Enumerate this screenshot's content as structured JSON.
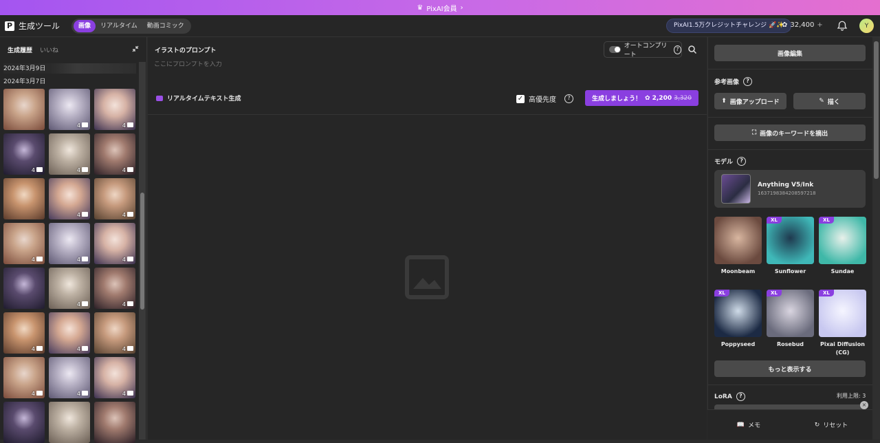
{
  "banner": {
    "label": "PixAI会員"
  },
  "header": {
    "app_title": "生成ツール",
    "modes": [
      "画像",
      "リアルタイム",
      "動画コミック"
    ],
    "challenge": "PixAI1.5万クレジットチャレンジ 🚀✨",
    "credits": "32,400",
    "credits_plus": "+",
    "avatar_initial": "Y"
  },
  "history": {
    "tabs": [
      "生成履歴",
      "いいね"
    ],
    "date1": "2024年3月9日",
    "date2": "2024年3月7日",
    "counts": [
      "",
      "4",
      "4",
      "4",
      "4",
      "4",
      "",
      "4",
      "4",
      "4",
      "4",
      "4",
      "",
      "4",
      "4",
      "4",
      "4",
      "4",
      "4",
      "4",
      "4",
      "",
      "",
      ""
    ]
  },
  "prompt": {
    "label": "イラストのプロンプト",
    "placeholder": "ここにプロンプトを入力",
    "autocomplete": "オートコンプリート",
    "realtime_label": "リアルタイムテキスト生成",
    "priority_label": "高優先度",
    "generate_label": "生成しましょう！",
    "generate_cost": "2,200",
    "generate_cost_orig": "3,320"
  },
  "right": {
    "edit_button": "画像編集",
    "reference_title": "参考画像",
    "upload_button": "画像アップロード",
    "draw_button": "描く",
    "extract_button": "画像のキーワードを摘出",
    "model_title": "モデル",
    "model_name": "Anything V5/Ink",
    "model_id": "1637198384208597218",
    "models": [
      {
        "name": "Moonbeam",
        "xl": ""
      },
      {
        "name": "Sunflower",
        "xl": "XL"
      },
      {
        "name": "Sundae",
        "xl": "XL"
      },
      {
        "name": "Poppyseed",
        "xl": "XL"
      },
      {
        "name": "Rosebud",
        "xl": "XL"
      },
      {
        "name": "Pixai Diffusion (CG)",
        "xl": "XL"
      }
    ],
    "more_button": "もっと表示する",
    "lora_title": "LoRA",
    "lora_limit": "利用上限: 3",
    "memo": "メモ",
    "reset": "リセット"
  }
}
